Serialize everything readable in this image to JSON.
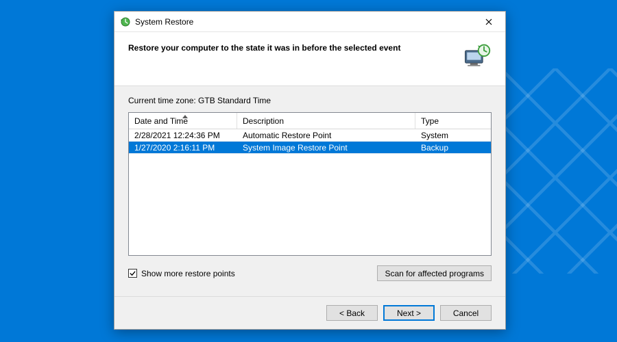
{
  "window": {
    "title": "System Restore"
  },
  "header": {
    "heading": "Restore your computer to the state it was in before the selected event"
  },
  "content": {
    "timezone_label": "Current time zone: GTB Standard Time",
    "columns": {
      "date": "Date and Time",
      "desc": "Description",
      "type": "Type"
    },
    "rows": [
      {
        "date": "2/28/2021 12:24:36 PM",
        "desc": "Automatic Restore Point",
        "type": "System",
        "selected": false
      },
      {
        "date": "1/27/2020 2:16:11 PM",
        "desc": "System Image Restore Point",
        "type": "Backup",
        "selected": true
      }
    ],
    "show_more_label": "Show more restore points",
    "show_more_checked": true,
    "scan_button": "Scan for affected programs"
  },
  "footer": {
    "back": "< Back",
    "next": "Next >",
    "cancel": "Cancel"
  },
  "colors": {
    "selection": "#0078d7"
  }
}
